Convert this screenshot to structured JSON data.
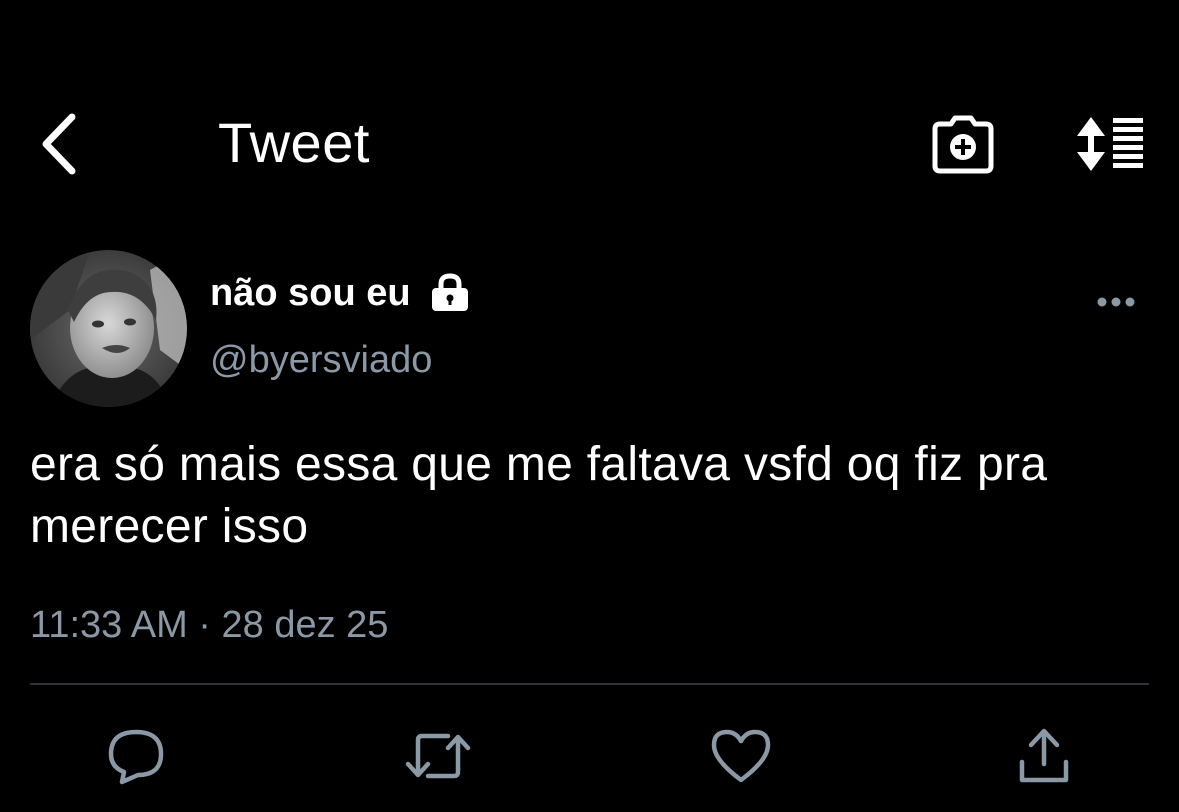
{
  "header": {
    "title": "Tweet",
    "back_icon": "chevron-left-icon",
    "camera_icon": "camera-plus-icon",
    "sort_icon": "sort-icon"
  },
  "author": {
    "display_name": "não sou eu",
    "handle": "@byersviado",
    "protected_icon": "lock-icon",
    "more_icon": "more-horizontal-icon"
  },
  "tweet": {
    "text": "era só mais essa que me faltava vsfd oq fiz pra merecer isso",
    "timestamp": "11:33 AM · 28 dez 25"
  },
  "actions": {
    "reply_icon": "reply-icon",
    "retweet_icon": "retweet-icon",
    "like_icon": "heart-icon",
    "share_icon": "share-icon"
  },
  "colors": {
    "background": "#000000",
    "text": "#ffffff",
    "secondary": "#8b98a5",
    "divider": "#2f3336"
  }
}
